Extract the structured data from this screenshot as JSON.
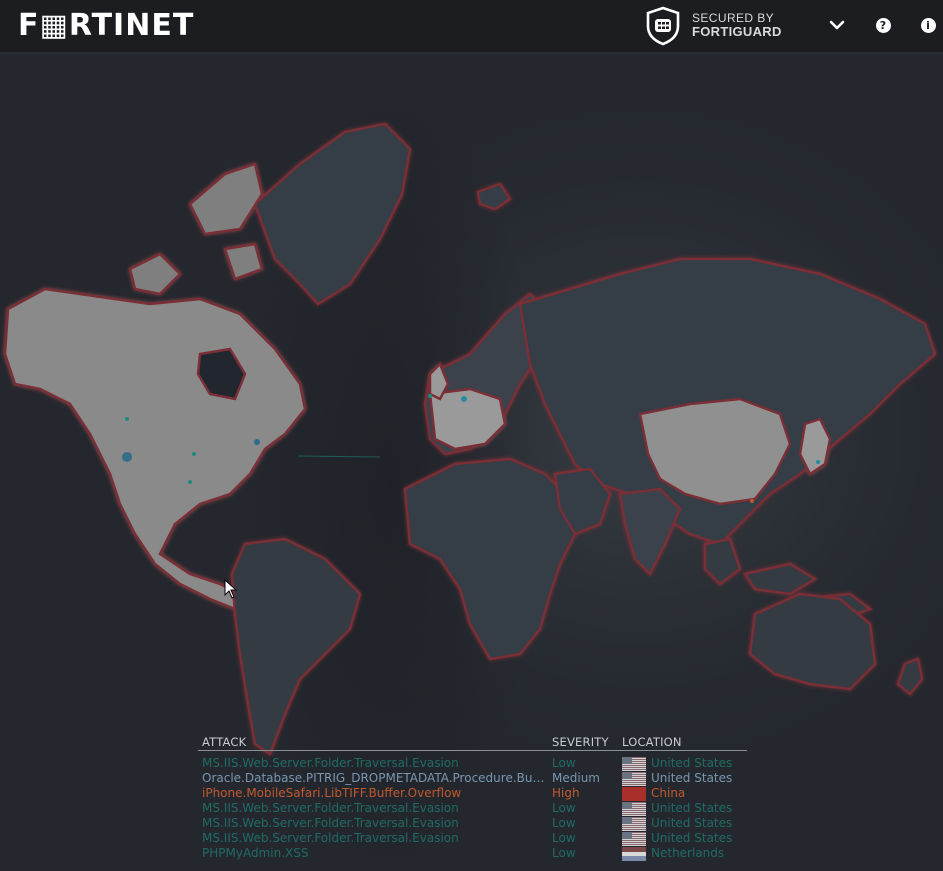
{
  "header": {
    "brand": "F▦RTINET",
    "secured_by": "SECURED BY",
    "fortiguard": "FORTIGUARD",
    "icons": [
      "fortiguard-shield-icon",
      "chevron-down-icon",
      "help-icon",
      "info-icon"
    ],
    "help_glyph": "?",
    "info_glyph": "i"
  },
  "colors": {
    "header_bg": "#1b1d21",
    "map_bg": "#24282e",
    "land": "#353c46",
    "land_highlight": "#8f8f8f",
    "border_glow": "#7a2f35",
    "low": "#1f6b63",
    "medium": "#7896b0",
    "high": "#c0582f"
  },
  "attack_table": {
    "headers": {
      "attack": "ATTACK",
      "severity": "SEVERITY",
      "location": "LOCATION"
    },
    "rows": [
      {
        "attack": "MS.IIS.Web.Server.Folder.Traversal.Evasion",
        "severity": "Low",
        "location": "United States",
        "flag": "us-flag-icon",
        "color": "#1f6b63"
      },
      {
        "attack": "Oracle.Database.PITRIG_DROPMETADATA.Procedure.Bu…",
        "severity": "Medium",
        "location": "United States",
        "flag": "us-flag-icon",
        "color": "#7896b0"
      },
      {
        "attack": "iPhone.MobileSafari.LibTIFF.Buffer.Overflow",
        "severity": "High",
        "location": "China",
        "flag": "china-flag-icon",
        "color": "#c0582f"
      },
      {
        "attack": "MS.IIS.Web.Server.Folder.Traversal.Evasion",
        "severity": "Low",
        "location": "United States",
        "flag": "us-flag-icon",
        "color": "#1f6b63"
      },
      {
        "attack": "MS.IIS.Web.Server.Folder.Traversal.Evasion",
        "severity": "Low",
        "location": "United States",
        "flag": "us-flag-icon",
        "color": "#1f6b63"
      },
      {
        "attack": "MS.IIS.Web.Server.Folder.Traversal.Evasion",
        "severity": "Low",
        "location": "United States",
        "flag": "us-flag-icon",
        "color": "#1f6b63"
      },
      {
        "attack": "PHPMyAdmin.XSS",
        "severity": "Low",
        "location": "Netherlands",
        "flag": "netherlands-flag-icon",
        "color": "#1f6b63"
      }
    ]
  }
}
